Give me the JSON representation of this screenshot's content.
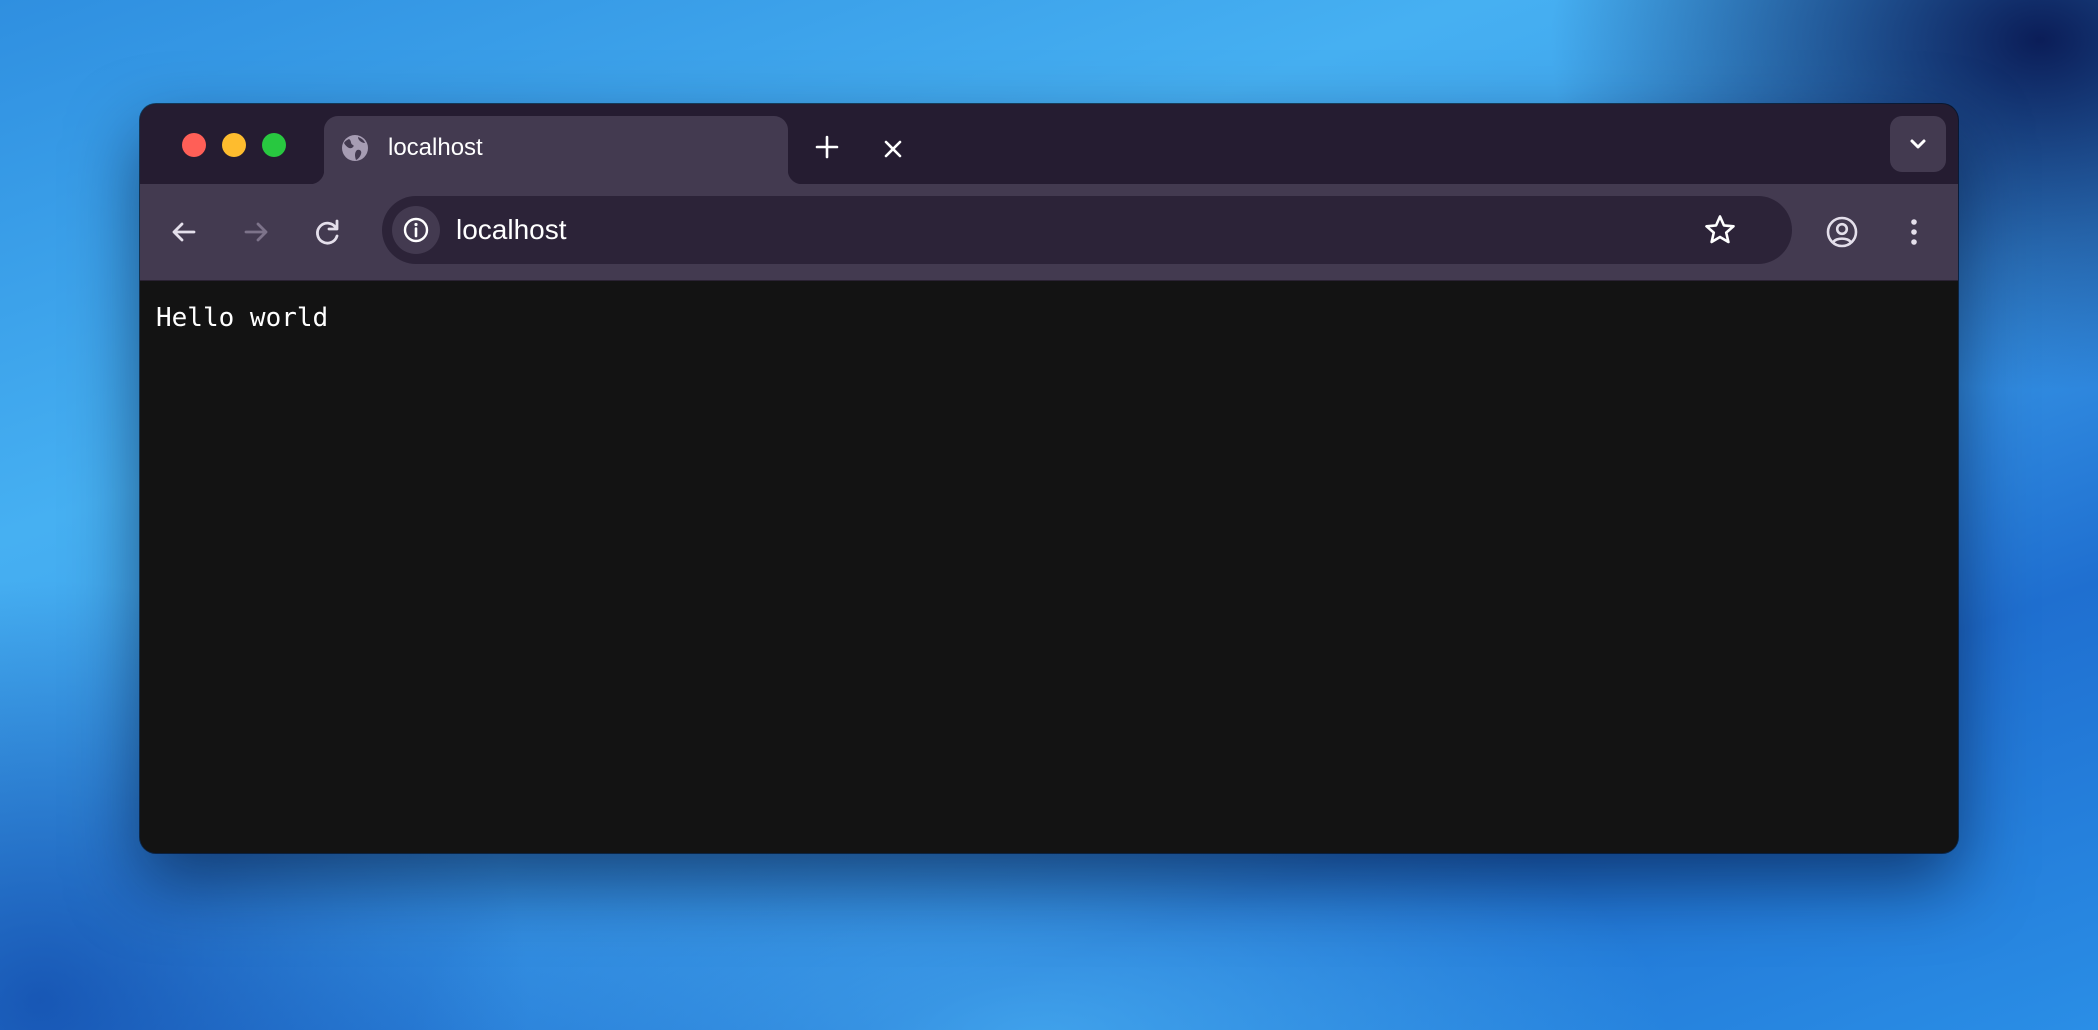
{
  "window": {
    "traffic_lights": {
      "close_color": "#ff5f57",
      "minimize_color": "#febc2e",
      "maximize_color": "#28c840"
    },
    "tabs": [
      {
        "title": "localhost",
        "favicon": "globe-icon",
        "active": true
      }
    ],
    "new_tab_icon": "plus-icon",
    "tab_search_icon": "chevron-down-icon"
  },
  "toolbar": {
    "back_icon": "arrow-left-icon",
    "forward_icon": "arrow-right-icon",
    "forward_enabled": false,
    "reload_icon": "reload-icon",
    "site_info_icon": "info-icon",
    "url": "localhost",
    "bookmark_icon": "star-icon",
    "profile_icon": "account-icon",
    "menu_icon": "more-vertical-icon"
  },
  "page": {
    "body_text": "Hello world",
    "background": "#131313",
    "text_color": "#ffffff"
  },
  "theme": {
    "titlebar_color": "#251c31",
    "toolbar_color": "#433a50",
    "omnibox_color": "#2c2338"
  }
}
